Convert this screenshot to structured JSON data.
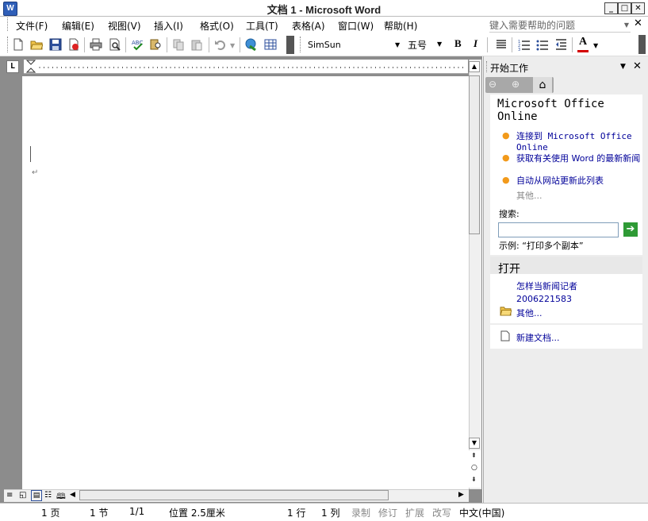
{
  "window": {
    "title": "文档 1 - Microsoft Word",
    "app_icon": "W"
  },
  "menu": {
    "items": [
      "文件(F)",
      "编辑(E)",
      "视图(V)",
      "插入(I)",
      "格式(O)",
      "工具(T)",
      "表格(A)",
      "窗口(W)",
      "帮助(H)"
    ],
    "help_placeholder": "键入需要帮助的问题"
  },
  "toolbar": {
    "font": "SimSun",
    "size": "五号",
    "bold": "B",
    "italic": "I",
    "font_color": "A",
    "font_color_hex": "#d40000"
  },
  "ruler": {
    "corner": "L"
  },
  "pane": {
    "title": "开始工作",
    "office_online": {
      "heading": "Microsoft Office Online",
      "links": [
        "连接到 Microsoft Office Online",
        "获取有关使用 Word 的最新新闻",
        "自动从网站更新此列表"
      ],
      "more": "其他..."
    },
    "search": {
      "label": "搜索:",
      "example": "示例: “打印多个副本”"
    },
    "open": {
      "heading": "打开",
      "files": [
        "怎样当新闻记者",
        "2006221583"
      ],
      "more": "其他...",
      "new_doc": "新建文档..."
    }
  },
  "status": {
    "page": "1 页",
    "section": "1 节",
    "pages": "1/1",
    "position": "位置 2.5厘米",
    "line": "1 行",
    "column": "1 列",
    "rec": "录制",
    "trk": "修订",
    "ext": "扩展",
    "ovr": "改写",
    "language": "中文(中国)"
  }
}
